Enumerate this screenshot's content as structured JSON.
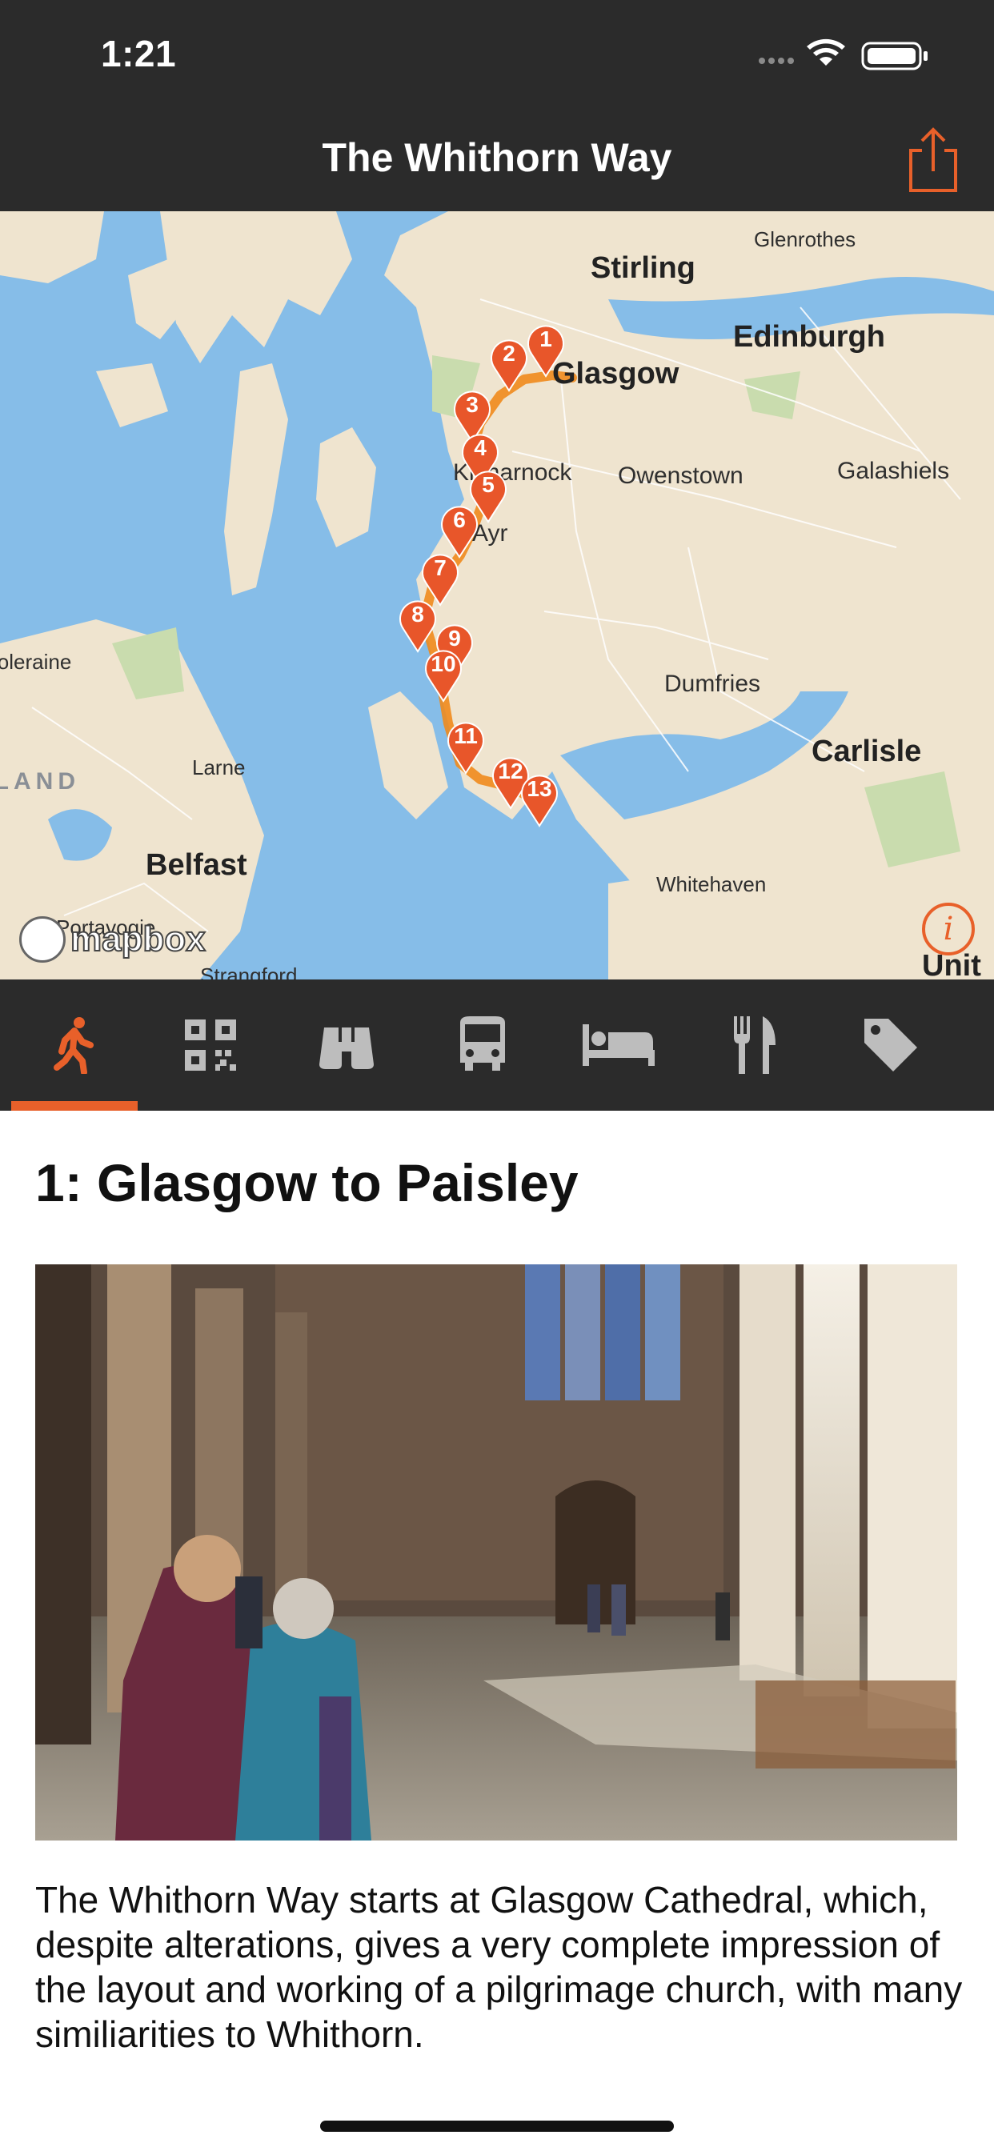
{
  "status_bar": {
    "time": "1:21"
  },
  "nav": {
    "title": "The Whithorn Way",
    "share_icon": "share-icon"
  },
  "map": {
    "labels": [
      "Glenrothes",
      "Stirling",
      "Edinburgh",
      "Glasgow",
      "Kilmarnock",
      "Owenstown",
      "Galashiels",
      "Ayr",
      "Coleraine",
      "Dumfries",
      "Carlisle",
      "Larne",
      "Belfast",
      "Whitehaven",
      "Strangford",
      "IRELAND",
      "Portavogie",
      "Unit"
    ],
    "markers": [
      "1",
      "2",
      "3",
      "4",
      "5",
      "6",
      "7",
      "8",
      "9",
      "10",
      "11",
      "12",
      "13"
    ],
    "attribution": "mapbox",
    "route_color": "#f08a1c",
    "marker_color": "#e8562a"
  },
  "tabs": [
    {
      "name": "walking",
      "icon": "walking-icon"
    },
    {
      "name": "qr",
      "icon": "qr-code-icon"
    },
    {
      "name": "sights",
      "icon": "binoculars-icon"
    },
    {
      "name": "transport",
      "icon": "bus-icon"
    },
    {
      "name": "accommodation",
      "icon": "bed-icon"
    },
    {
      "name": "food",
      "icon": "fork-knife-icon"
    },
    {
      "name": "offers",
      "icon": "tag-icon"
    }
  ],
  "active_tab_index": 0,
  "content": {
    "title": "1: Glasgow to Paisley",
    "image_alt": "Interior of Glasgow Cathedral with visitors",
    "body": "The Whithorn Way starts at Glasgow Cathedral, which, despite alterations, gives a very complete impression of the layout and working of a pilgrimage church, with many similiarities to Whithorn."
  },
  "accent_color": "#e8602a"
}
